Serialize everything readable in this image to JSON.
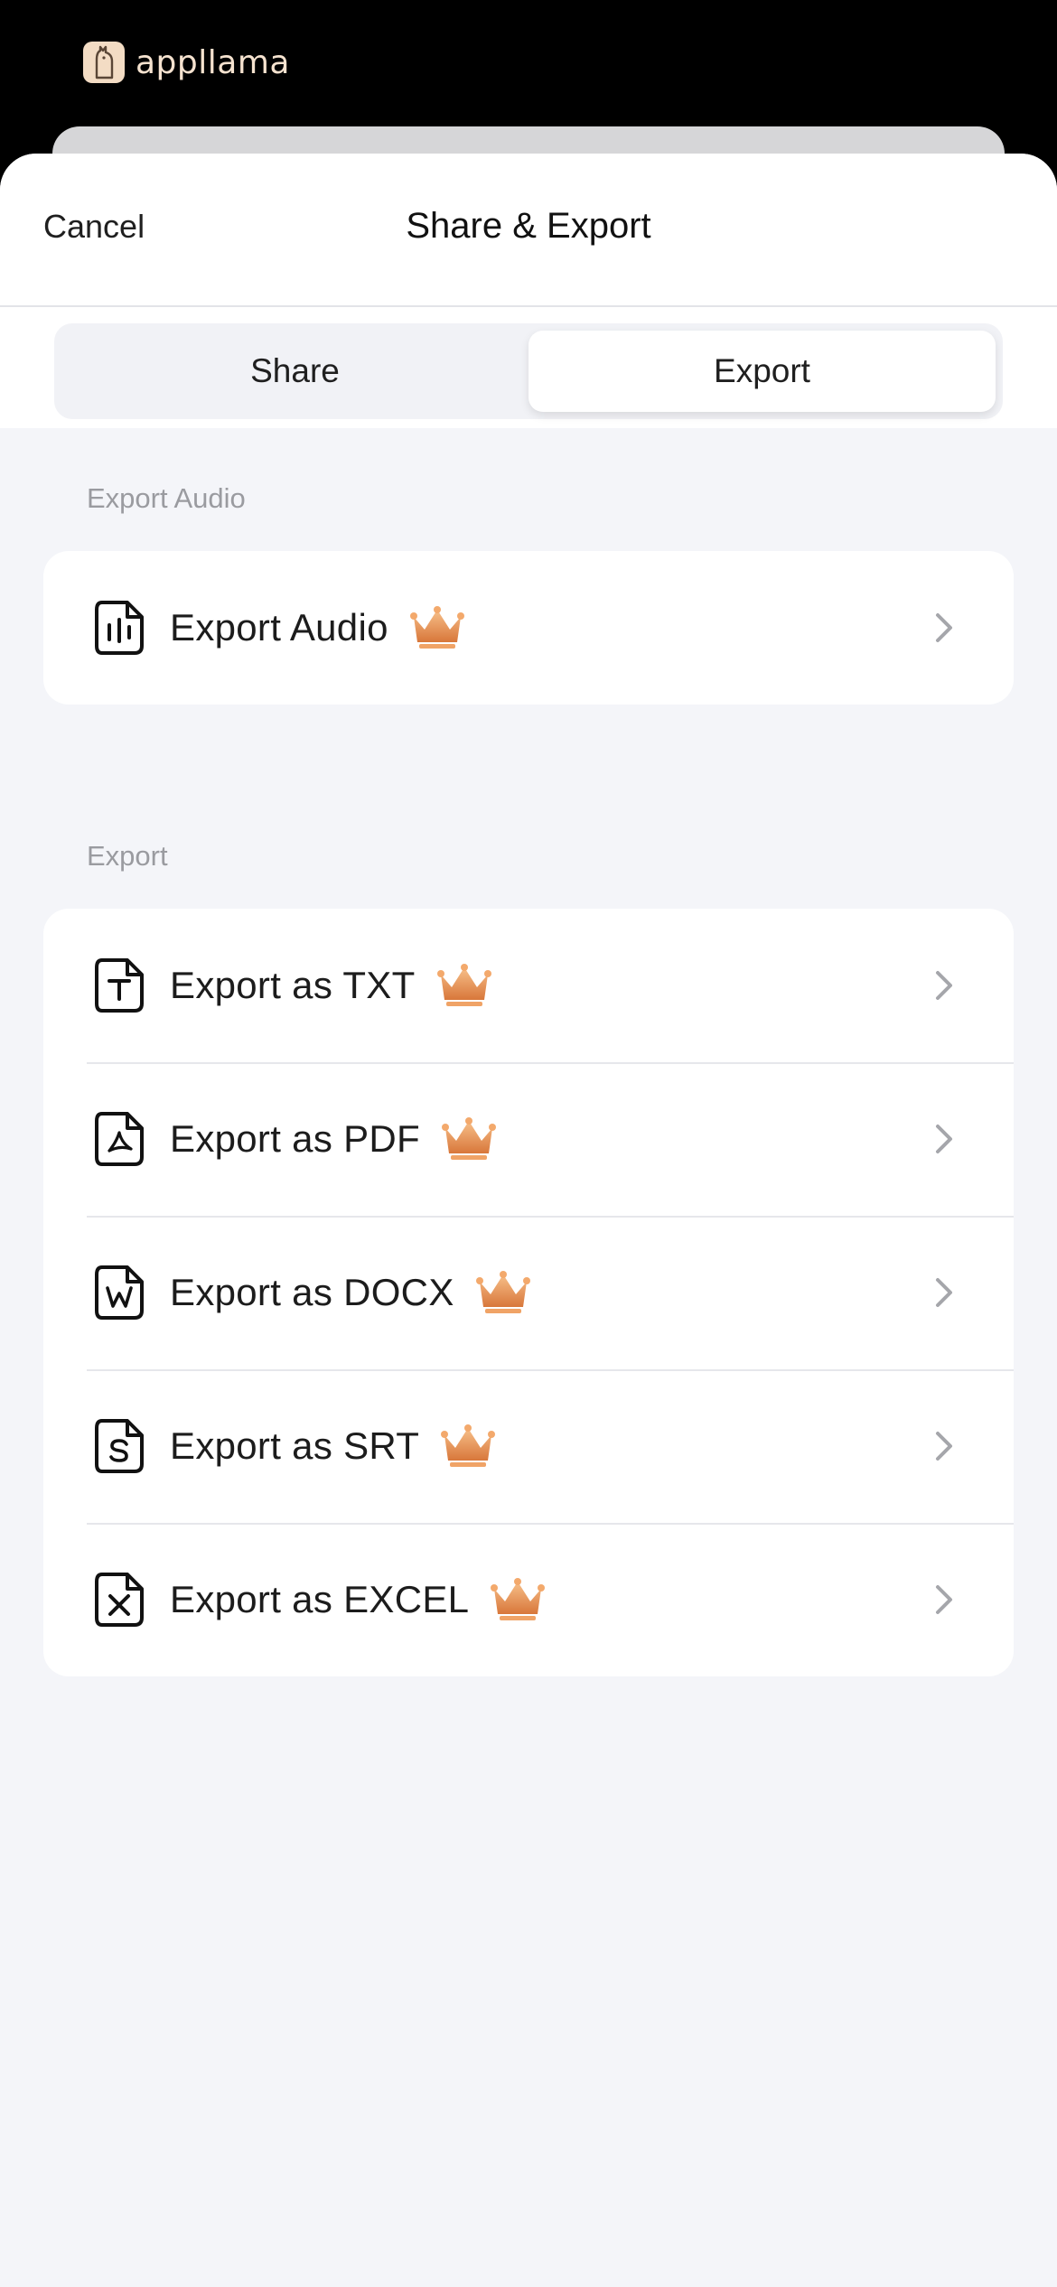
{
  "brand": {
    "name": "appllama",
    "logo_icon": "llama-icon"
  },
  "sheet": {
    "cancel_label": "Cancel",
    "title": "Share & Export"
  },
  "segments": [
    {
      "label": "Share",
      "active": false
    },
    {
      "label": "Export",
      "active": true
    }
  ],
  "sections": [
    {
      "label": "Export Audio",
      "items": [
        {
          "label": "Export Audio",
          "icon": "audio-file-icon",
          "premium": true
        }
      ]
    },
    {
      "label": "Export",
      "items": [
        {
          "label": "Export as TXT",
          "icon": "txt-file-icon",
          "premium": true
        },
        {
          "label": "Export as PDF",
          "icon": "pdf-file-icon",
          "premium": true
        },
        {
          "label": "Export as DOCX",
          "icon": "docx-file-icon",
          "premium": true
        },
        {
          "label": "Export as SRT",
          "icon": "srt-file-icon",
          "premium": true
        },
        {
          "label": "Export as EXCEL",
          "icon": "excel-file-icon",
          "premium": true
        }
      ]
    }
  ],
  "colors": {
    "crown_light": "#f6b77a",
    "crown_dark": "#d9793a",
    "background": "#f4f5f9",
    "chevron": "#a5a6ab"
  }
}
